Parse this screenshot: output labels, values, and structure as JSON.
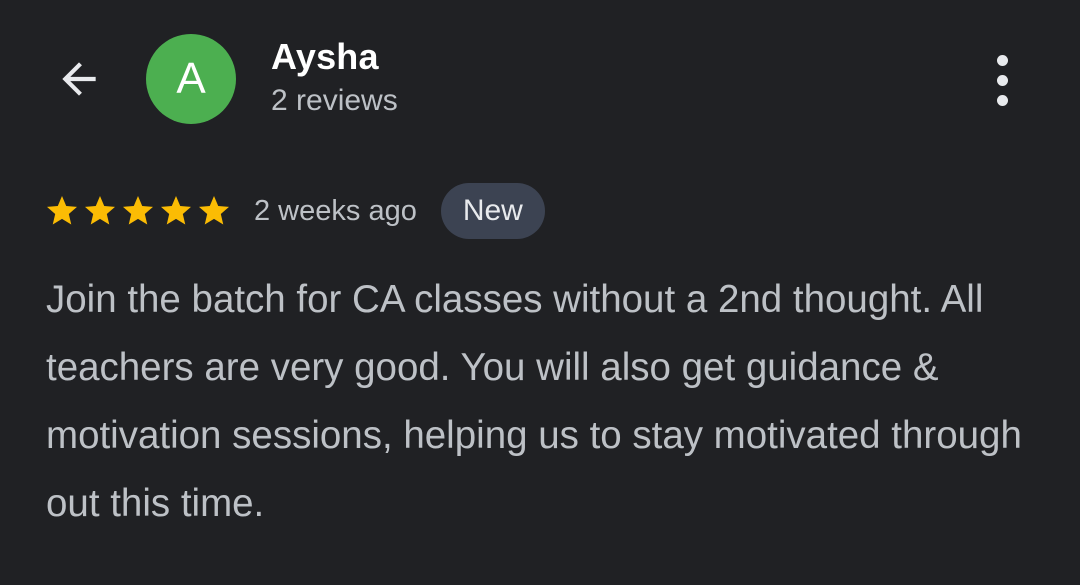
{
  "reviewer": {
    "initial": "A",
    "avatar_color": "#4caf50",
    "name": "Aysha",
    "reviews_count": "2 reviews"
  },
  "icons": {
    "back": "arrow-back-icon",
    "menu": "more-vert-icon",
    "star": "star-icon"
  },
  "review": {
    "rating": 5,
    "max_rating": 5,
    "star_color": "#fbbc04",
    "time_ago": "2 weeks ago",
    "badge": "New",
    "text": "Join the batch for CA classes without a 2nd thought. All teachers are very good. You will also get guidance & motivation sessions, helping us to stay motivated through out this time."
  }
}
